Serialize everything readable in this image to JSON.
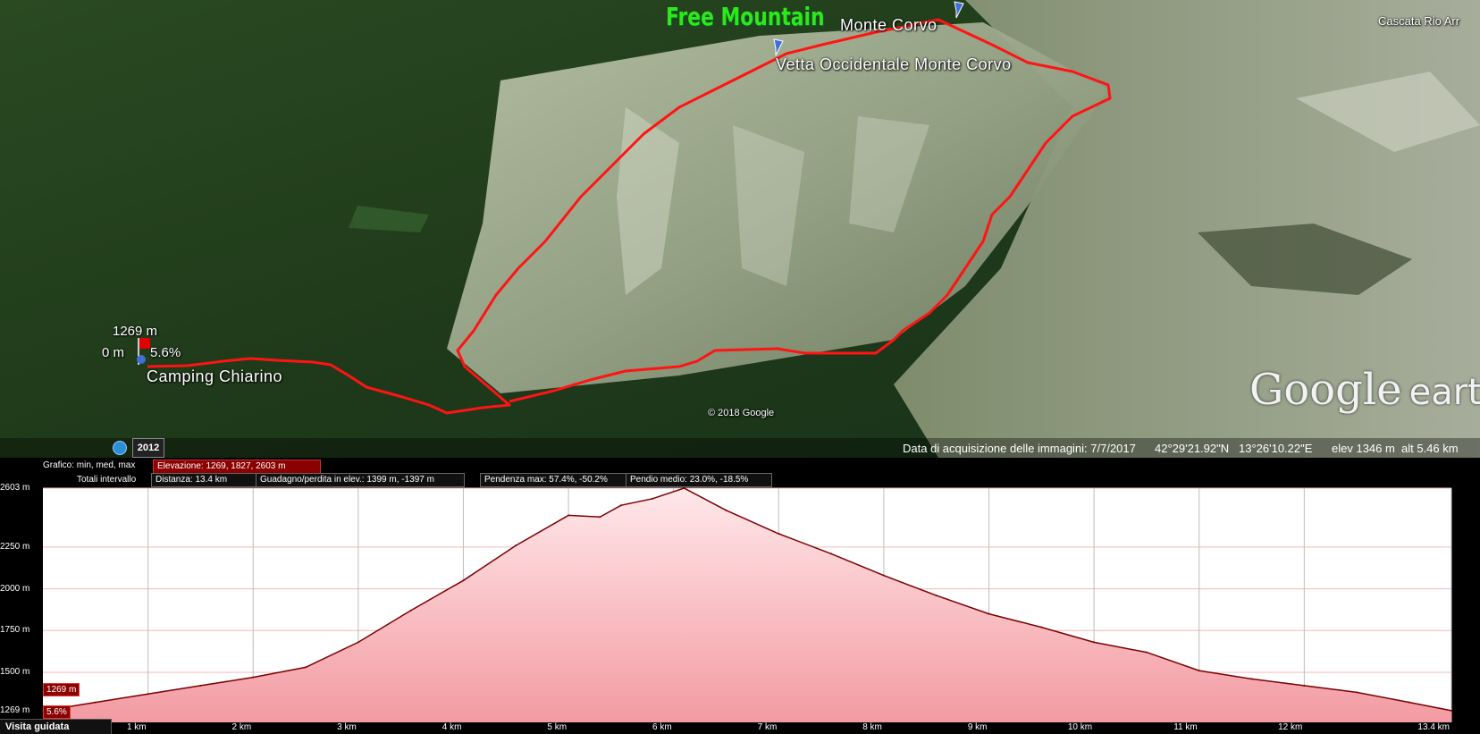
{
  "map": {
    "brand": "Free Mountain",
    "labels": {
      "monte_corvo": "Monte Corvo",
      "vetta": "Vetta Occidentale Monte Corvo",
      "cascata": "Cascata Rio Arr",
      "camping": "Camping Chiarino",
      "pin_elev": "1269 m",
      "pin_dist": "0 m",
      "pin_slope": "5.6%",
      "copyright": "© 2018 Google"
    },
    "logo_main": "Google",
    "logo_suffix": "earth",
    "year": "2012",
    "status": {
      "acquisition": "Data di acquisizione delle immagini: 7/7/2017",
      "lat": "42°29'21.92\"N",
      "lon": "13°26'10.22\"E",
      "elev": "elev  1346 m",
      "alt": "alt  5.46 km"
    },
    "icons": [
      "pushpin-icon",
      "flag-icon",
      "clock-icon"
    ],
    "colors": {
      "track": "#ff1414",
      "brand": "#2ee81a"
    }
  },
  "profile": {
    "header": {
      "graph_label": "Grafico: min, med, max",
      "elevation": "Elevazione: 1269, 1827, 2603 m",
      "totals_label": "Totali intervallo",
      "distance": "Distanza: 13.4 km",
      "gain_loss": "Guadagno/perdita in elev.: 1399 m, -1397 m",
      "max_slope": "Pendenza max: 57.4%, -50.2%",
      "avg_slope": "Pendio medio: 23.0%, -18.5%"
    },
    "marker_elev": "1269 m",
    "marker_slope": "5.6%",
    "guided_tour": "Visita guidata"
  },
  "chart_data": {
    "type": "area",
    "xlabel": "",
    "ylabel": "",
    "x_ticks": [
      "1 km",
      "2 km",
      "3 km",
      "4 km",
      "5 km",
      "6 km",
      "7 km",
      "8 km",
      "9 km",
      "10 km",
      "11 km",
      "12 km",
      "13.4 km"
    ],
    "y_ticks": [
      "2603 m",
      "2250 m",
      "2000 m",
      "1750 m",
      "1500 m",
      "1269 m"
    ],
    "xlim": [
      0,
      13.4
    ],
    "ylim": [
      1200,
      2603
    ],
    "grid": true,
    "colors": {
      "line": "#7a0000",
      "fill_top": "#ffe8ea",
      "fill_bottom": "#f39aa2"
    },
    "x": [
      0,
      0.5,
      1,
      1.5,
      2,
      2.5,
      3,
      3.5,
      4,
      4.5,
      5,
      5.3,
      5.5,
      5.8,
      6.1,
      6.5,
      7,
      7.5,
      8,
      8.5,
      9,
      9.5,
      10,
      10.5,
      11,
      11.5,
      12,
      12.5,
      13,
      13.4
    ],
    "y": [
      1269,
      1320,
      1370,
      1420,
      1470,
      1530,
      1680,
      1870,
      2050,
      2260,
      2440,
      2430,
      2500,
      2540,
      2603,
      2470,
      2330,
      2210,
      2080,
      1960,
      1850,
      1770,
      1680,
      1620,
      1510,
      1460,
      1420,
      1380,
      1320,
      1270
    ]
  }
}
